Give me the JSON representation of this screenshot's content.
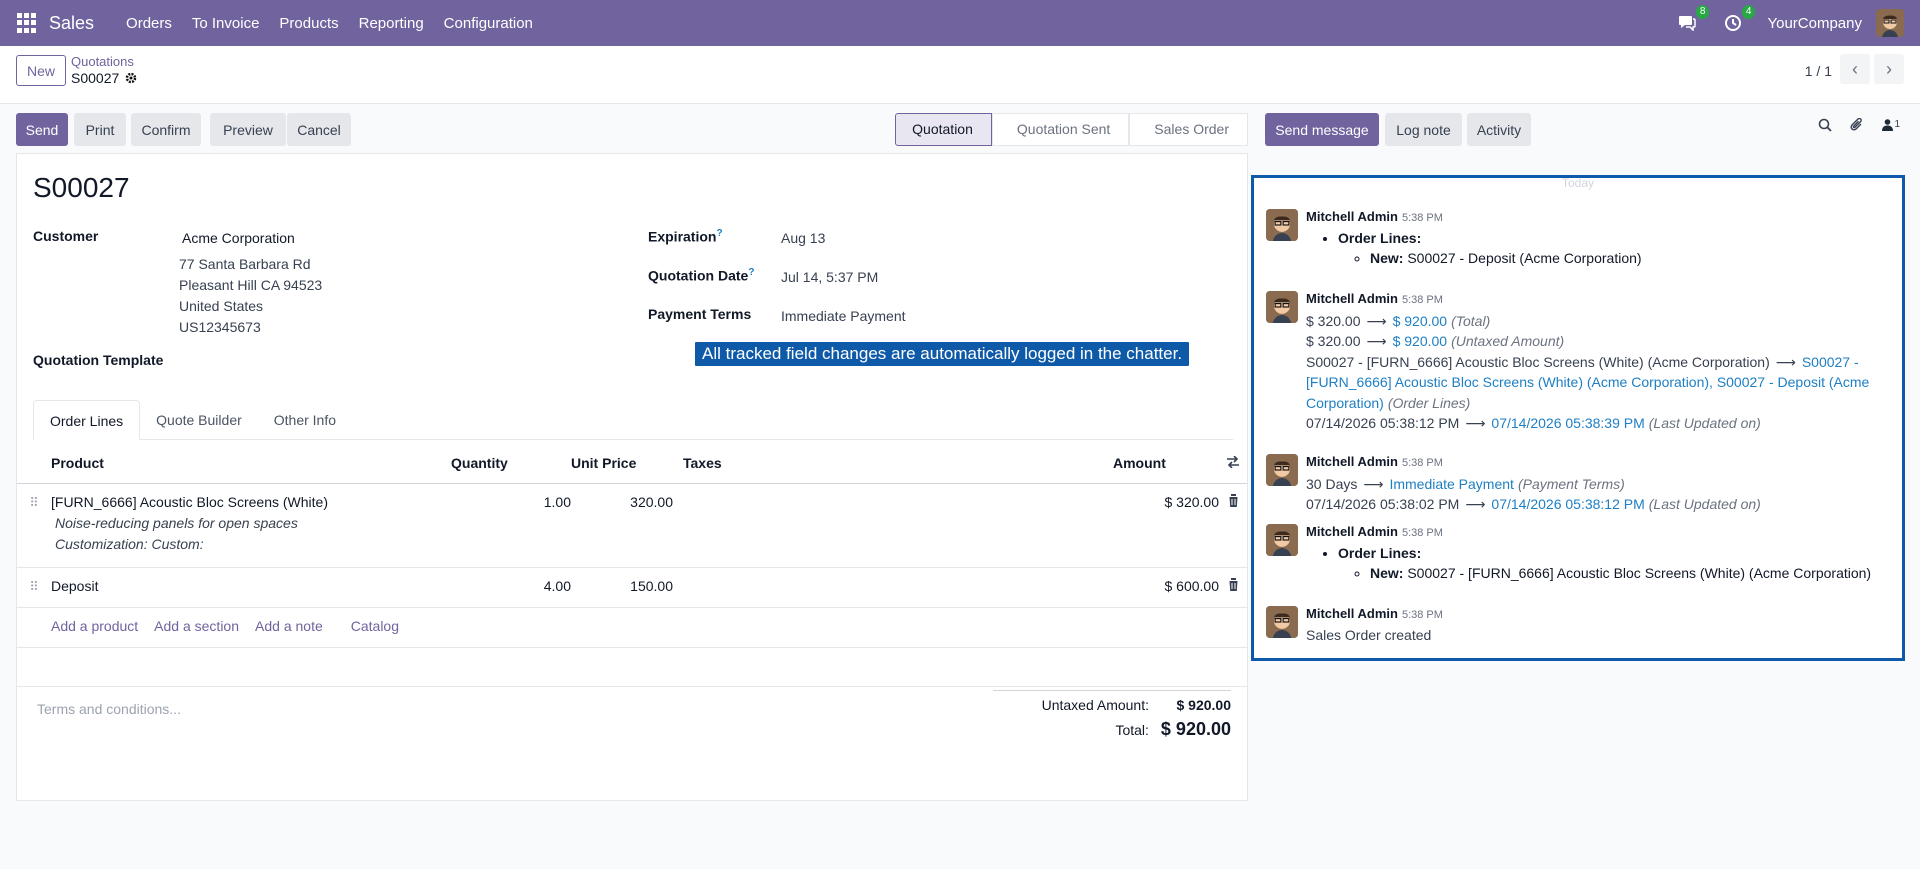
{
  "navbar": {
    "app_name": "Sales",
    "menu": [
      "Orders",
      "To Invoice",
      "Products",
      "Reporting",
      "Configuration"
    ],
    "messages_badge": "8",
    "activities_badge": "4",
    "company": "YourCompany",
    "bg_color": "#71639e"
  },
  "control_panel": {
    "new_label": "New",
    "breadcrumb": "Quotations",
    "record": "S00027",
    "pager": "1 / 1"
  },
  "actions": {
    "send": "Send",
    "print": "Print",
    "confirm": "Confirm",
    "preview": "Preview",
    "cancel": "Cancel"
  },
  "stages": [
    "Quotation",
    "Quotation Sent",
    "Sales Order"
  ],
  "form": {
    "title": "S00027",
    "customer_label": "Customer",
    "customer_name": "Acme Corporation",
    "customer_address": [
      "77 Santa Barbara Rd",
      "Pleasant Hill CA 94523",
      "United States",
      "US12345673"
    ],
    "template_label": "Quotation Template",
    "expiration_label": "Expiration",
    "expiration_value": "Aug 13",
    "quotation_date_label": "Quotation Date",
    "quotation_date_value": "Jul 14, 5:37 PM",
    "payment_terms_label": "Payment Terms",
    "payment_terms_value": "Immediate Payment",
    "help_mark": "?"
  },
  "tabs": [
    "Order Lines",
    "Quote Builder",
    "Other Info"
  ],
  "order_lines": {
    "headers": {
      "product": "Product",
      "quantity": "Quantity",
      "unit_price": "Unit Price",
      "taxes": "Taxes",
      "amount": "Amount"
    },
    "rows": [
      {
        "product": "[FURN_6666] Acoustic Bloc Screens (White)",
        "notes": [
          "Noise-reducing panels for open spaces",
          "Customization: Custom:"
        ],
        "quantity": "1.00",
        "unit_price": "320.00",
        "taxes": "",
        "amount": "$ 320.00"
      },
      {
        "product": "Deposit",
        "notes": [],
        "quantity": "4.00",
        "unit_price": "150.00",
        "taxes": "",
        "amount": "$ 600.00"
      }
    ],
    "add_links": {
      "product": "Add a product",
      "section": "Add a section",
      "note": "Add a note",
      "catalog": "Catalog"
    }
  },
  "terms_placeholder": "Terms and conditions...",
  "totals": {
    "untaxed_label": "Untaxed Amount:",
    "untaxed_value": "$ 920.00",
    "total_label": "Total:",
    "total_value": "$ 920.00"
  },
  "tooltip": "All tracked field changes are automatically logged in the chatter.",
  "chatter": {
    "send_message": "Send message",
    "log_note": "Log note",
    "activity": "Activity",
    "followers_count": "1",
    "today": "Today",
    "messages": [
      {
        "author": "Mitchell Admin",
        "time": "5:38 PM",
        "list_title": "Order Lines:",
        "new_label": "New:",
        "new_value": "S00027 - Deposit (Acme Corporation)"
      },
      {
        "author": "Mitchell Admin",
        "time": "5:38 PM",
        "changes": [
          {
            "old": "$ 320.00",
            "new": "$ 920.00",
            "field": "(Total)"
          },
          {
            "old": "$ 320.00",
            "new": "$ 920.00",
            "field": "(Untaxed Amount)"
          },
          {
            "old": "S00027 - [FURN_6666] Acoustic Bloc Screens (White) (Acme Corporation)",
            "new_line1": "S00027 -",
            "new_line2": "[FURN_6666] Acoustic Bloc Screens (White) (Acme Corporation), S00027 - Deposit (Acme",
            "new_line3": "Corporation)",
            "field": "(Order Lines)"
          },
          {
            "old": "07/14/2026 05:38:12 PM",
            "new": "07/14/2026 05:38:39 PM",
            "field": "(Last Updated on)"
          }
        ]
      },
      {
        "author": "Mitchell Admin",
        "time": "5:38 PM",
        "changes": [
          {
            "old": "30 Days",
            "new": "Immediate Payment",
            "field": "(Payment Terms)"
          },
          {
            "old": "07/14/2026 05:38:02 PM",
            "new": "07/14/2026 05:38:12 PM",
            "field": "(Last Updated on)"
          }
        ]
      },
      {
        "author": "Mitchell Admin",
        "time": "5:38 PM",
        "list_title": "Order Lines:",
        "new_label": "New:",
        "new_value": "S00027 - [FURN_6666] Acoustic Bloc Screens (White) (Acme Corporation)"
      },
      {
        "author": "Mitchell Admin",
        "time": "5:38 PM",
        "text": "Sales Order created"
      }
    ]
  }
}
